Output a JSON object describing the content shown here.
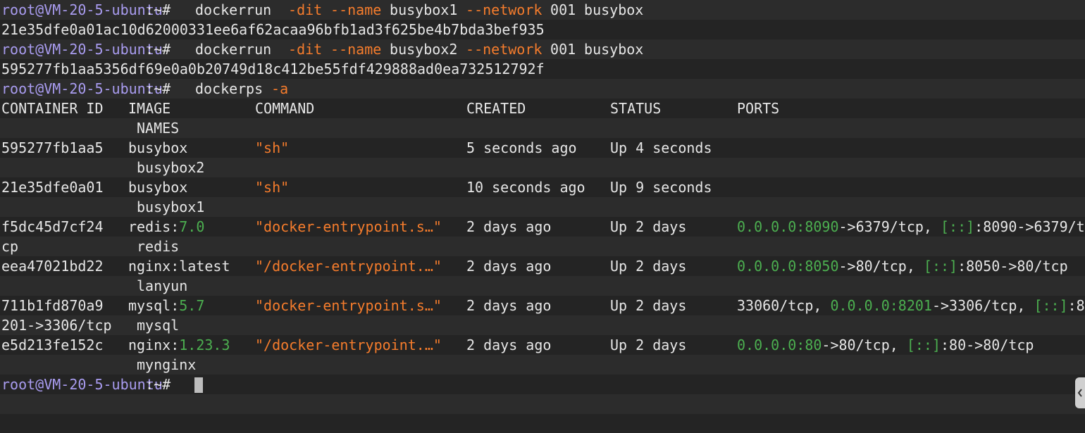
{
  "terminal": {
    "prompt": {
      "user_host": "root@VM-20-5-ubuntu",
      "path_suffix": ":~#"
    },
    "commands": [
      {
        "parts": [
          "docker",
          " run",
          " -dit",
          " --name",
          " busybox1",
          " --network",
          " 001",
          " busybox"
        ],
        "output": "21e35dfe0a01ac10d62000331ee6af62acaa96bfb1ad3f625be4b7bda3bef935"
      },
      {
        "parts": [
          "docker",
          " run",
          " -dit",
          " --name",
          " busybox2",
          " --network",
          " 001",
          " busybox"
        ],
        "output": "595277fb1aa5356df69e0a0b20749d18c412be55fdf429888ad0ea732512792f"
      },
      {
        "parts": [
          "docker",
          " ps",
          " -a"
        ]
      }
    ],
    "ps_header": {
      "container_id": "CONTAINER ID",
      "image": "IMAGE",
      "command": "COMMAND",
      "created": "CREATED",
      "status": "STATUS",
      "ports": "PORTS",
      "names": "NAMES"
    },
    "ps_rows": [
      {
        "id": "595277fb1aa5",
        "image_name": "busybox",
        "image_tag": "",
        "command": "\"sh\"",
        "created": "5 seconds ago",
        "status": "Up 4 seconds",
        "ports": [],
        "name": "busybox2"
      },
      {
        "id": "21e35dfe0a01",
        "image_name": "busybox",
        "image_tag": "",
        "command": "\"sh\"",
        "created": "10 seconds ago",
        "status": "Up 9 seconds",
        "ports": [],
        "name": "busybox1"
      },
      {
        "id": "f5dc45d7cf24",
        "image_name": "redis:",
        "image_tag": "7.0",
        "command": "\"docker-entrypoint.s…\"",
        "created": "2 days ago",
        "status": "Up 2 days",
        "ports_line1": [
          {
            "t": "0.0.0.0:8090",
            "c": "green"
          },
          {
            "t": "->6379/tcp, ",
            "c": "white"
          },
          {
            "t": "[::]",
            "c": "green"
          },
          {
            "t": ":8090->6379/t",
            "c": "white"
          }
        ],
        "wrap_prefix": "cp",
        "name": "redis"
      },
      {
        "id": "eea47021bd22",
        "image_name": "nginx:latest",
        "image_tag": "",
        "command": "\"/docker-entrypoint.…\"",
        "created": "2 days ago",
        "status": "Up 2 days",
        "ports_line1": [
          {
            "t": "0.0.0.0:8050",
            "c": "green"
          },
          {
            "t": "->80/tcp, ",
            "c": "white"
          },
          {
            "t": "[::]",
            "c": "green"
          },
          {
            "t": ":8050->80/tcp",
            "c": "white"
          }
        ],
        "wrap_prefix": "",
        "name": "lanyun"
      },
      {
        "id": "711b1fd870a9",
        "image_name": "mysql:",
        "image_tag": "5.7",
        "command": "\"docker-entrypoint.s…\"",
        "created": "2 days ago",
        "status": "Up 2 days",
        "ports_line1": [
          {
            "t": "33060/tcp, ",
            "c": "white"
          },
          {
            "t": "0.0.0.0:8201",
            "c": "green"
          },
          {
            "t": "->3306/tcp, ",
            "c": "white"
          },
          {
            "t": "[::]",
            "c": "green"
          },
          {
            "t": ":8",
            "c": "white"
          }
        ],
        "wrap_prefix": "201->3306/tcp",
        "name": "mysql"
      },
      {
        "id": "e5d213fe152c",
        "image_name": "nginx:",
        "image_tag": "1.23.3",
        "command": "\"/docker-entrypoint.…\"",
        "created": "2 days ago",
        "status": "Up 2 days",
        "ports_line1": [
          {
            "t": "0.0.0.0:80",
            "c": "green"
          },
          {
            "t": "->80/tcp, ",
            "c": "white"
          },
          {
            "t": "[::]",
            "c": "green"
          },
          {
            "t": ":80->80/tcp",
            "c": "white"
          }
        ],
        "wrap_prefix": "",
        "name": "mynginx"
      }
    ]
  },
  "side_panel_toggle": {
    "icon": "chevron-left-icon"
  }
}
